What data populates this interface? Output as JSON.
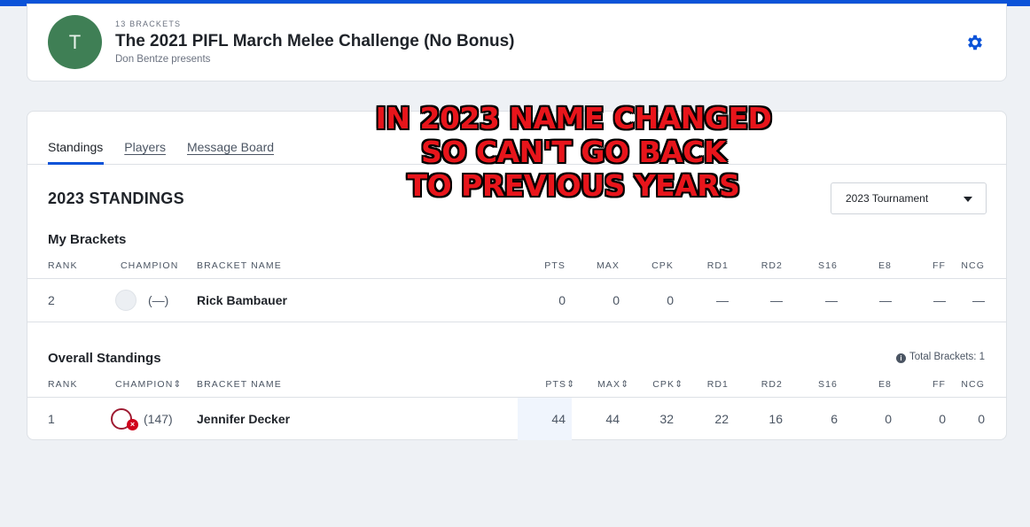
{
  "pool": {
    "bracket_count": "13 BRACKETS",
    "avatar_letter": "T",
    "title": "The 2021 PIFL March Melee Challenge (No Bonus)",
    "presenter": "Don Bentze presents"
  },
  "tabs": [
    {
      "label": "Standings",
      "active": true
    },
    {
      "label": "Players",
      "active": false
    },
    {
      "label": "Message Board",
      "active": false
    }
  ],
  "standings": {
    "title": "2023 STANDINGS",
    "tournament_select": "2023 Tournament"
  },
  "overlay_text": [
    "IN 2023 NAME CHANGED",
    "SO CAN'T GO BACK",
    "TO PREVIOUS YEARS"
  ],
  "my_brackets": {
    "title": "My Brackets",
    "headers": [
      "RANK",
      "CHAMPION",
      "BRACKET NAME",
      "PTS",
      "MAX",
      "CPK",
      "RD1",
      "RD2",
      "S16",
      "E8",
      "FF",
      "NCG"
    ],
    "rows": [
      {
        "rank": "2",
        "champion_seed": "(—)",
        "name": "Rick Bambauer",
        "pts": "0",
        "max": "0",
        "cpk": "0",
        "rd1": "—",
        "rd2": "—",
        "s16": "—",
        "e8": "—",
        "ff": "—",
        "ncg": "—"
      }
    ]
  },
  "overall": {
    "title": "Overall Standings",
    "total_brackets": "Total Brackets: 1",
    "headers": [
      "RANK",
      "CHAMPION",
      "BRACKET NAME",
      "PTS",
      "MAX",
      "CPK",
      "RD1",
      "RD2",
      "S16",
      "E8",
      "FF",
      "NCG"
    ],
    "rows": [
      {
        "rank": "1",
        "champion_seed": "(147)",
        "name": "Jennifer Decker",
        "pts": "44",
        "max": "44",
        "cpk": "32",
        "rd1": "22",
        "rd2": "16",
        "s16": "6",
        "e8": "0",
        "ff": "0",
        "ncg": "0"
      }
    ]
  },
  "colors": {
    "accent": "#0b53d8",
    "avatar": "#3f7f55",
    "overlay_text": "#e8151b",
    "eliminated": "#d0021b"
  },
  "icons": {
    "settings": "gear-icon",
    "sort": "sort-icon",
    "info": "info-icon",
    "eliminated": "x-badge-icon"
  }
}
